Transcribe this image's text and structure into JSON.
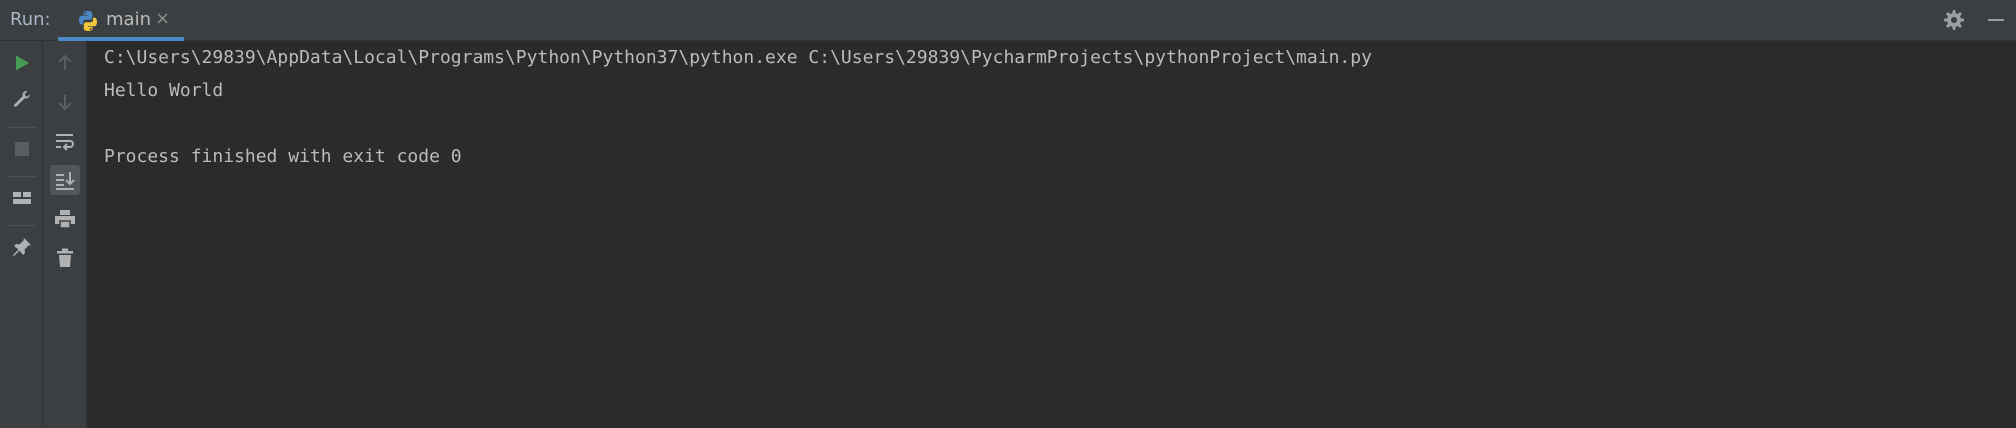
{
  "panel": {
    "title": "Run:",
    "tab": {
      "label": "main",
      "close": "×",
      "icon": "python-icon"
    }
  },
  "header_actions": [
    {
      "name": "settings",
      "icon": "gear-icon"
    },
    {
      "name": "hide",
      "icon": "minimize-icon"
    }
  ],
  "toolbar_left": [
    {
      "name": "rerun",
      "icon": "play-icon"
    },
    {
      "name": "edit-config",
      "icon": "wrench-icon"
    },
    {
      "name": "stop",
      "icon": "stop-icon"
    },
    {
      "name": "restore-layout",
      "icon": "layout-icon"
    },
    {
      "name": "pin-tab",
      "icon": "pin-icon"
    }
  ],
  "toolbar_right": [
    {
      "name": "up-stack-trace",
      "icon": "arrow-up-icon"
    },
    {
      "name": "down-stack-trace",
      "icon": "arrow-down-icon"
    },
    {
      "name": "soft-wrap",
      "icon": "soft-wrap-icon"
    },
    {
      "name": "scroll-to-end",
      "icon": "scroll-to-end-icon"
    },
    {
      "name": "print",
      "icon": "print-icon"
    },
    {
      "name": "clear-all",
      "icon": "trash-icon"
    }
  ],
  "console": {
    "lines": [
      "C:\\Users\\29839\\AppData\\Local\\Programs\\Python\\Python37\\python.exe C:\\Users\\29839\\PycharmProjects\\pythonProject\\main.py",
      "Hello World",
      "",
      "Process finished with exit code 0"
    ]
  },
  "colors": {
    "background": "#2b2b2b",
    "toolbar": "#3c3f41",
    "tab_underline": "#4a88c7",
    "run_green": "#499c54",
    "text": "#bbbbbb"
  }
}
